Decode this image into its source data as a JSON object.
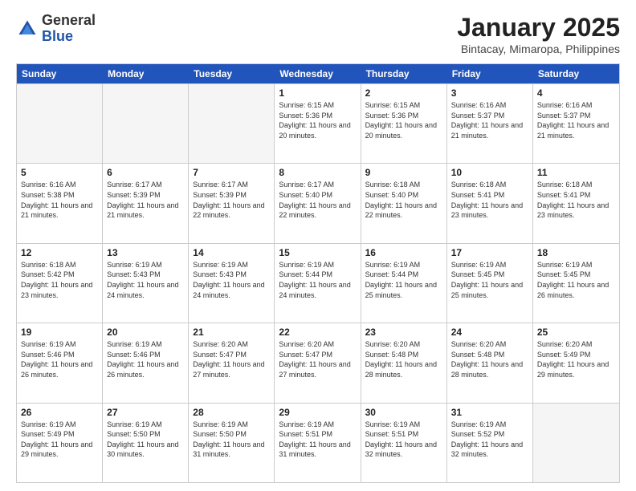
{
  "logo": {
    "general": "General",
    "blue": "Blue"
  },
  "title": "January 2025",
  "location": "Bintacay, Mimaropa, Philippines",
  "days": [
    "Sunday",
    "Monday",
    "Tuesday",
    "Wednesday",
    "Thursday",
    "Friday",
    "Saturday"
  ],
  "weeks": [
    [
      {
        "day": "",
        "info": ""
      },
      {
        "day": "",
        "info": ""
      },
      {
        "day": "",
        "info": ""
      },
      {
        "day": "1",
        "info": "Sunrise: 6:15 AM\nSunset: 5:36 PM\nDaylight: 11 hours and 20 minutes."
      },
      {
        "day": "2",
        "info": "Sunrise: 6:15 AM\nSunset: 5:36 PM\nDaylight: 11 hours and 20 minutes."
      },
      {
        "day": "3",
        "info": "Sunrise: 6:16 AM\nSunset: 5:37 PM\nDaylight: 11 hours and 21 minutes."
      },
      {
        "day": "4",
        "info": "Sunrise: 6:16 AM\nSunset: 5:37 PM\nDaylight: 11 hours and 21 minutes."
      }
    ],
    [
      {
        "day": "5",
        "info": "Sunrise: 6:16 AM\nSunset: 5:38 PM\nDaylight: 11 hours and 21 minutes."
      },
      {
        "day": "6",
        "info": "Sunrise: 6:17 AM\nSunset: 5:39 PM\nDaylight: 11 hours and 21 minutes."
      },
      {
        "day": "7",
        "info": "Sunrise: 6:17 AM\nSunset: 5:39 PM\nDaylight: 11 hours and 22 minutes."
      },
      {
        "day": "8",
        "info": "Sunrise: 6:17 AM\nSunset: 5:40 PM\nDaylight: 11 hours and 22 minutes."
      },
      {
        "day": "9",
        "info": "Sunrise: 6:18 AM\nSunset: 5:40 PM\nDaylight: 11 hours and 22 minutes."
      },
      {
        "day": "10",
        "info": "Sunrise: 6:18 AM\nSunset: 5:41 PM\nDaylight: 11 hours and 23 minutes."
      },
      {
        "day": "11",
        "info": "Sunrise: 6:18 AM\nSunset: 5:41 PM\nDaylight: 11 hours and 23 minutes."
      }
    ],
    [
      {
        "day": "12",
        "info": "Sunrise: 6:18 AM\nSunset: 5:42 PM\nDaylight: 11 hours and 23 minutes."
      },
      {
        "day": "13",
        "info": "Sunrise: 6:19 AM\nSunset: 5:43 PM\nDaylight: 11 hours and 24 minutes."
      },
      {
        "day": "14",
        "info": "Sunrise: 6:19 AM\nSunset: 5:43 PM\nDaylight: 11 hours and 24 minutes."
      },
      {
        "day": "15",
        "info": "Sunrise: 6:19 AM\nSunset: 5:44 PM\nDaylight: 11 hours and 24 minutes."
      },
      {
        "day": "16",
        "info": "Sunrise: 6:19 AM\nSunset: 5:44 PM\nDaylight: 11 hours and 25 minutes."
      },
      {
        "day": "17",
        "info": "Sunrise: 6:19 AM\nSunset: 5:45 PM\nDaylight: 11 hours and 25 minutes."
      },
      {
        "day": "18",
        "info": "Sunrise: 6:19 AM\nSunset: 5:45 PM\nDaylight: 11 hours and 26 minutes."
      }
    ],
    [
      {
        "day": "19",
        "info": "Sunrise: 6:19 AM\nSunset: 5:46 PM\nDaylight: 11 hours and 26 minutes."
      },
      {
        "day": "20",
        "info": "Sunrise: 6:19 AM\nSunset: 5:46 PM\nDaylight: 11 hours and 26 minutes."
      },
      {
        "day": "21",
        "info": "Sunrise: 6:20 AM\nSunset: 5:47 PM\nDaylight: 11 hours and 27 minutes."
      },
      {
        "day": "22",
        "info": "Sunrise: 6:20 AM\nSunset: 5:47 PM\nDaylight: 11 hours and 27 minutes."
      },
      {
        "day": "23",
        "info": "Sunrise: 6:20 AM\nSunset: 5:48 PM\nDaylight: 11 hours and 28 minutes."
      },
      {
        "day": "24",
        "info": "Sunrise: 6:20 AM\nSunset: 5:48 PM\nDaylight: 11 hours and 28 minutes."
      },
      {
        "day": "25",
        "info": "Sunrise: 6:20 AM\nSunset: 5:49 PM\nDaylight: 11 hours and 29 minutes."
      }
    ],
    [
      {
        "day": "26",
        "info": "Sunrise: 6:19 AM\nSunset: 5:49 PM\nDaylight: 11 hours and 29 minutes."
      },
      {
        "day": "27",
        "info": "Sunrise: 6:19 AM\nSunset: 5:50 PM\nDaylight: 11 hours and 30 minutes."
      },
      {
        "day": "28",
        "info": "Sunrise: 6:19 AM\nSunset: 5:50 PM\nDaylight: 11 hours and 31 minutes."
      },
      {
        "day": "29",
        "info": "Sunrise: 6:19 AM\nSunset: 5:51 PM\nDaylight: 11 hours and 31 minutes."
      },
      {
        "day": "30",
        "info": "Sunrise: 6:19 AM\nSunset: 5:51 PM\nDaylight: 11 hours and 32 minutes."
      },
      {
        "day": "31",
        "info": "Sunrise: 6:19 AM\nSunset: 5:52 PM\nDaylight: 11 hours and 32 minutes."
      },
      {
        "day": "",
        "info": ""
      }
    ]
  ]
}
